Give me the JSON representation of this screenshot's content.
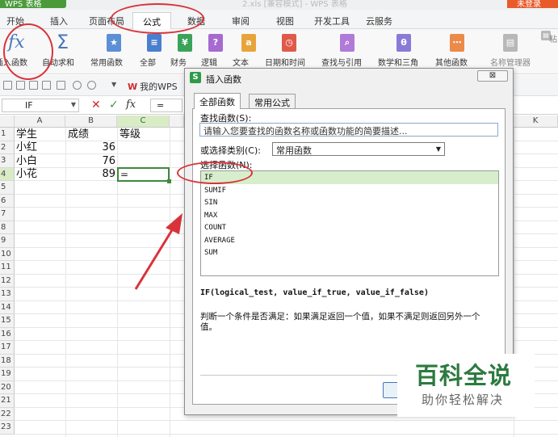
{
  "titlebar": {
    "app": "WPS 表格",
    "document": "2.xls  [兼容模式] - WPS 表格",
    "login": "未登录"
  },
  "menu_tabs": [
    "开始",
    "插入",
    "页面布局",
    "公式",
    "数据",
    "审阅",
    "视图",
    "开发工具",
    "云服务"
  ],
  "active_tab": "公式",
  "ribbon": {
    "insert_function": "插入函数",
    "autosum": "自动求和",
    "common": "常用函数",
    "all": "全部",
    "financial": "财务",
    "logical": "逻辑",
    "text": "文本",
    "datetime": "日期和时间",
    "lookup": "查找与引用",
    "math": "数学和三角",
    "other": "其他函数",
    "name_manager": "名称管理器",
    "paste": "粘"
  },
  "quick_toolbar": {
    "my_wps": "我的WPS"
  },
  "formula_bar": {
    "name_box": "IF",
    "content": "=",
    "fx": "fx"
  },
  "sheet": {
    "columns": [
      "A",
      "B",
      "C",
      "K"
    ],
    "rows": [
      "1",
      "2",
      "3",
      "4",
      "5",
      "6",
      "7",
      "8",
      "9",
      "10",
      "11",
      "12",
      "13",
      "14",
      "15",
      "16",
      "17",
      "18",
      "19",
      "20",
      "21",
      "22",
      "23"
    ],
    "cells": {
      "a1": "学生",
      "b1": "成绩",
      "c1": "等级",
      "a2": "小红",
      "b2": "36",
      "a3": "小白",
      "b3": "76",
      "a4": "小花",
      "b4": "89",
      "c4": "="
    }
  },
  "dialog": {
    "title": "插入函数",
    "close": "⊠",
    "tabs": [
      "全部函数",
      "常用公式"
    ],
    "search_label": "查找函数(S):",
    "search_placeholder": "请输入您要查找的函数名称或函数功能的简要描述...",
    "category_label": "或选择类别(C):",
    "category_value": "常用函数",
    "select_label": "选择函数(N):",
    "functions": [
      "IF",
      "SUMIF",
      "SIN",
      "MAX",
      "COUNT",
      "AVERAGE",
      "SUM"
    ],
    "selected_function": "IF",
    "signature": "IF(logical_test, value_if_true, value_if_false)",
    "description": "判断一个条件是否满足：如果满足返回一个值，如果不满足则返回另外一个值。"
  },
  "watermark": {
    "big": "百科全说",
    "small": "助你轻松解决"
  },
  "colors": {
    "annotation_red": "#d8333a",
    "selection_green": "#d7eecc",
    "brand_green": "#2c7a3f"
  }
}
